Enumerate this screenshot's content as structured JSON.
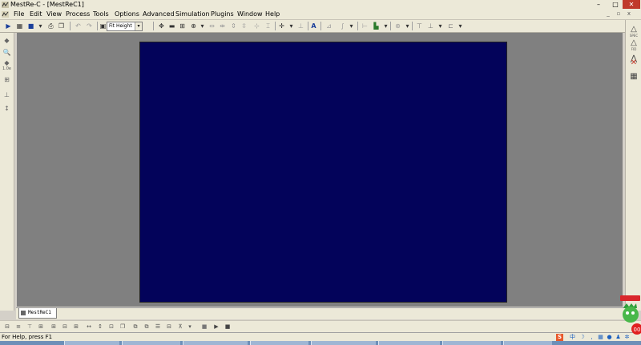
{
  "window": {
    "title": "MestRe-C - [MestReC1]"
  },
  "window_controls": {
    "minimize": "–",
    "maximize": "□",
    "close": "✕"
  },
  "mdi_controls": {
    "minimize": "_",
    "restore": "▫",
    "close": "x"
  },
  "menu": [
    "File",
    "Edit",
    "View",
    "Process",
    "Tools",
    "Options",
    "Advanced",
    "Simulation",
    "Plugins",
    "Window",
    "Help"
  ],
  "toolbar": {
    "zoom_select": "Fit Height"
  },
  "left_tools": {
    "label_1": "1.0e",
    "items": [
      "cursor-icon",
      "zoom-icon",
      "peak-icon",
      "integrate-icon",
      "cut-icon",
      "phase-icon"
    ]
  },
  "right_tools": {
    "label_1": "SPEC",
    "label_2": "FID"
  },
  "doc_tab": "MestReC1",
  "status": {
    "message": "For Help, press F1"
  },
  "tray": {
    "ime_label": "中",
    "badge": "00"
  },
  "colors": {
    "plot_background": "#03035a",
    "workspace": "#808080",
    "chrome": "#ece9d8"
  }
}
